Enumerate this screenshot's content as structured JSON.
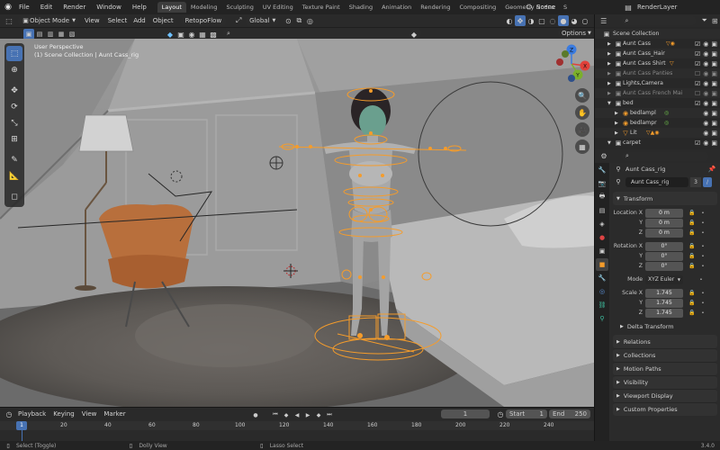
{
  "menubar": {
    "menus": [
      "File",
      "Edit",
      "Render",
      "Window",
      "Help"
    ],
    "workspaces": [
      "Layout",
      "Modeling",
      "Sculpting",
      "UV Editing",
      "Texture Paint",
      "Shading",
      "Animation",
      "Rendering",
      "Compositing",
      "Geometry Nodes",
      "S"
    ],
    "active_workspace": "Layout",
    "scene": "Scene",
    "view_layer": "RenderLayer"
  },
  "viewport_header": {
    "mode": "Object Mode",
    "menus": [
      "View",
      "Select",
      "Add",
      "Object"
    ],
    "addon": "RetopoFlow",
    "orientation": "Global",
    "options": "Options"
  },
  "viewport": {
    "overlay_title": "User Perspective",
    "overlay_subtitle": "(1) Scene Collection | Aunt Cass_rig",
    "gizmo_axes": [
      "X",
      "Y",
      "Z"
    ]
  },
  "timeline": {
    "menus": [
      "Playback",
      "Keying",
      "View",
      "Marker"
    ],
    "current_frame": "1",
    "start_label": "Start",
    "start_value": "1",
    "end_label": "End",
    "end_value": "250",
    "ticks": [
      "1",
      "20",
      "40",
      "60",
      "80",
      "100",
      "120",
      "140",
      "160",
      "180",
      "200",
      "220",
      "240"
    ]
  },
  "statusbar": {
    "items": [
      "Select (Toggle)",
      "Dolly View",
      "Lasso Select"
    ],
    "version": "3.4.0"
  },
  "outliner": {
    "root": "Scene Collection",
    "items": [
      {
        "label": "Aunt Cass",
        "dim": false
      },
      {
        "label": "Aunt Cass_Hair",
        "dim": false
      },
      {
        "label": "Aunt Cass Shirt",
        "dim": false
      },
      {
        "label": "Aunt Cass Panties",
        "dim": true
      },
      {
        "label": "Lights,Camera",
        "dim": false
      },
      {
        "label": "Aunt Cass French Mai",
        "dim": true
      },
      {
        "label": "bed",
        "dim": false
      },
      {
        "label": "bedlampl",
        "dim": false
      },
      {
        "label": "bedlampr",
        "dim": false
      },
      {
        "label": "Lit",
        "dim": false
      },
      {
        "label": "carpet",
        "dim": false
      }
    ]
  },
  "properties": {
    "object_name": "Aunt Cass_rig",
    "data_name": "Aunt Cass_rig",
    "users": "3",
    "transform_label": "Transform",
    "location_label": "Location X",
    "rotation_label": "Rotation X",
    "scale_label": "Scale X",
    "axis_y": "Y",
    "axis_z": "Z",
    "location": [
      "0 m",
      "0 m",
      "0 m"
    ],
    "rotation": [
      "0°",
      "0°",
      "0°"
    ],
    "mode_label": "Mode",
    "mode_value": "XYZ Euler",
    "scale": [
      "1.745",
      "1.745",
      "1.745"
    ],
    "delta_transform": "Delta Transform",
    "panels": [
      "Relations",
      "Collections",
      "Motion Paths",
      "Visibility",
      "Viewport Display",
      "Custom Properties"
    ]
  },
  "colors": {
    "accent": "#4772b3",
    "selection": "#f59c2b",
    "active_ws": "#3d3d3d"
  }
}
